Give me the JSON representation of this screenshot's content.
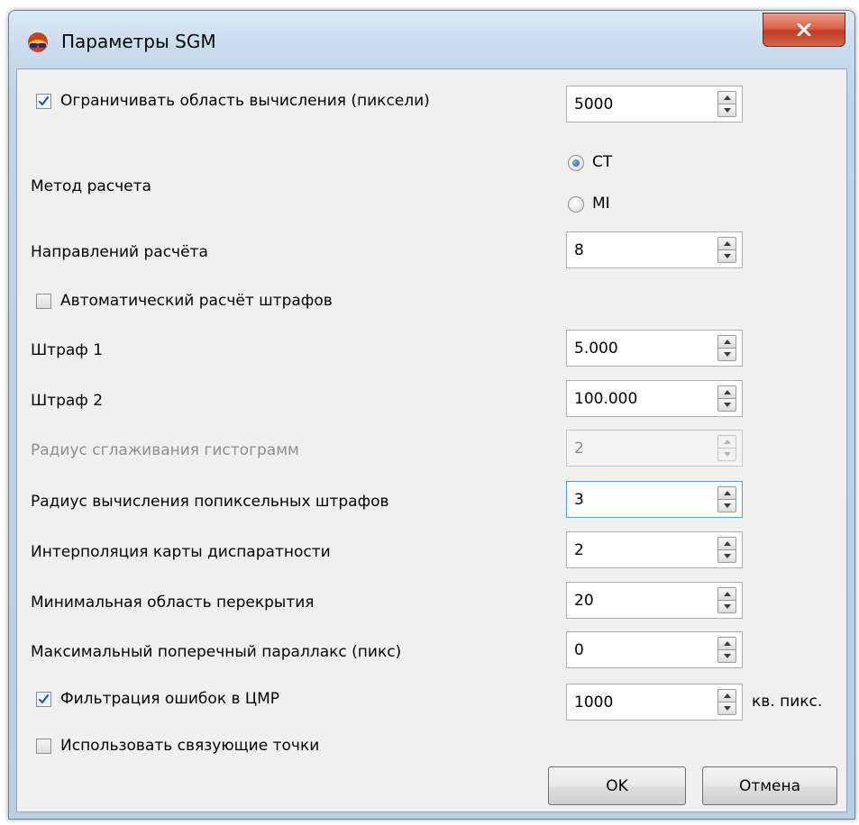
{
  "window": {
    "title": "Параметры SGM"
  },
  "rows": {
    "limit_area": {
      "label": "Ограничивать область вычисления (пиксели)",
      "checked": true,
      "value": "5000"
    },
    "method": {
      "label": "Метод расчета",
      "options": [
        "CT",
        "MI"
      ],
      "selected": "CT"
    },
    "directions": {
      "label": "Направлений расчёта",
      "value": "8"
    },
    "auto_penalty": {
      "label": "Автоматический расчёт штрафов",
      "checked": false
    },
    "penalty1": {
      "label": "Штраф 1",
      "value": "5.000"
    },
    "penalty2": {
      "label": "Штраф 2",
      "value": "100.000"
    },
    "hist_radius": {
      "label": "Радиус сглаживания гистограмм",
      "value": "2",
      "disabled": true
    },
    "pixel_penalty_radius": {
      "label": "Радиус вычисления попиксельных штрафов",
      "value": "3"
    },
    "disparity_interp": {
      "label": "Интерполяция карты диспаратности",
      "value": "2"
    },
    "min_overlap": {
      "label": "Минимальная область перекрытия",
      "value": "20"
    },
    "max_parallax": {
      "label": "Максимальный поперечный параллакс (пикс)",
      "value": "0"
    },
    "dem_filter": {
      "label": "Фильтрация ошибок в ЦМР",
      "checked": true,
      "value": "1000",
      "unit": "кв. пикс."
    },
    "tie_points": {
      "label": "Использовать связующие точки",
      "checked": false
    }
  },
  "buttons": {
    "ok": "OK",
    "cancel": "Отмена"
  },
  "colors": {
    "accent": "#1d5aa8",
    "close_button": "#c3391f",
    "dialog_bg": "#f0f0f0",
    "disabled_text": "#8e8e8e"
  },
  "icons": {
    "app": "anaglyph-glasses-icon",
    "close": "close-x-icon",
    "check": "checkmark-icon"
  }
}
